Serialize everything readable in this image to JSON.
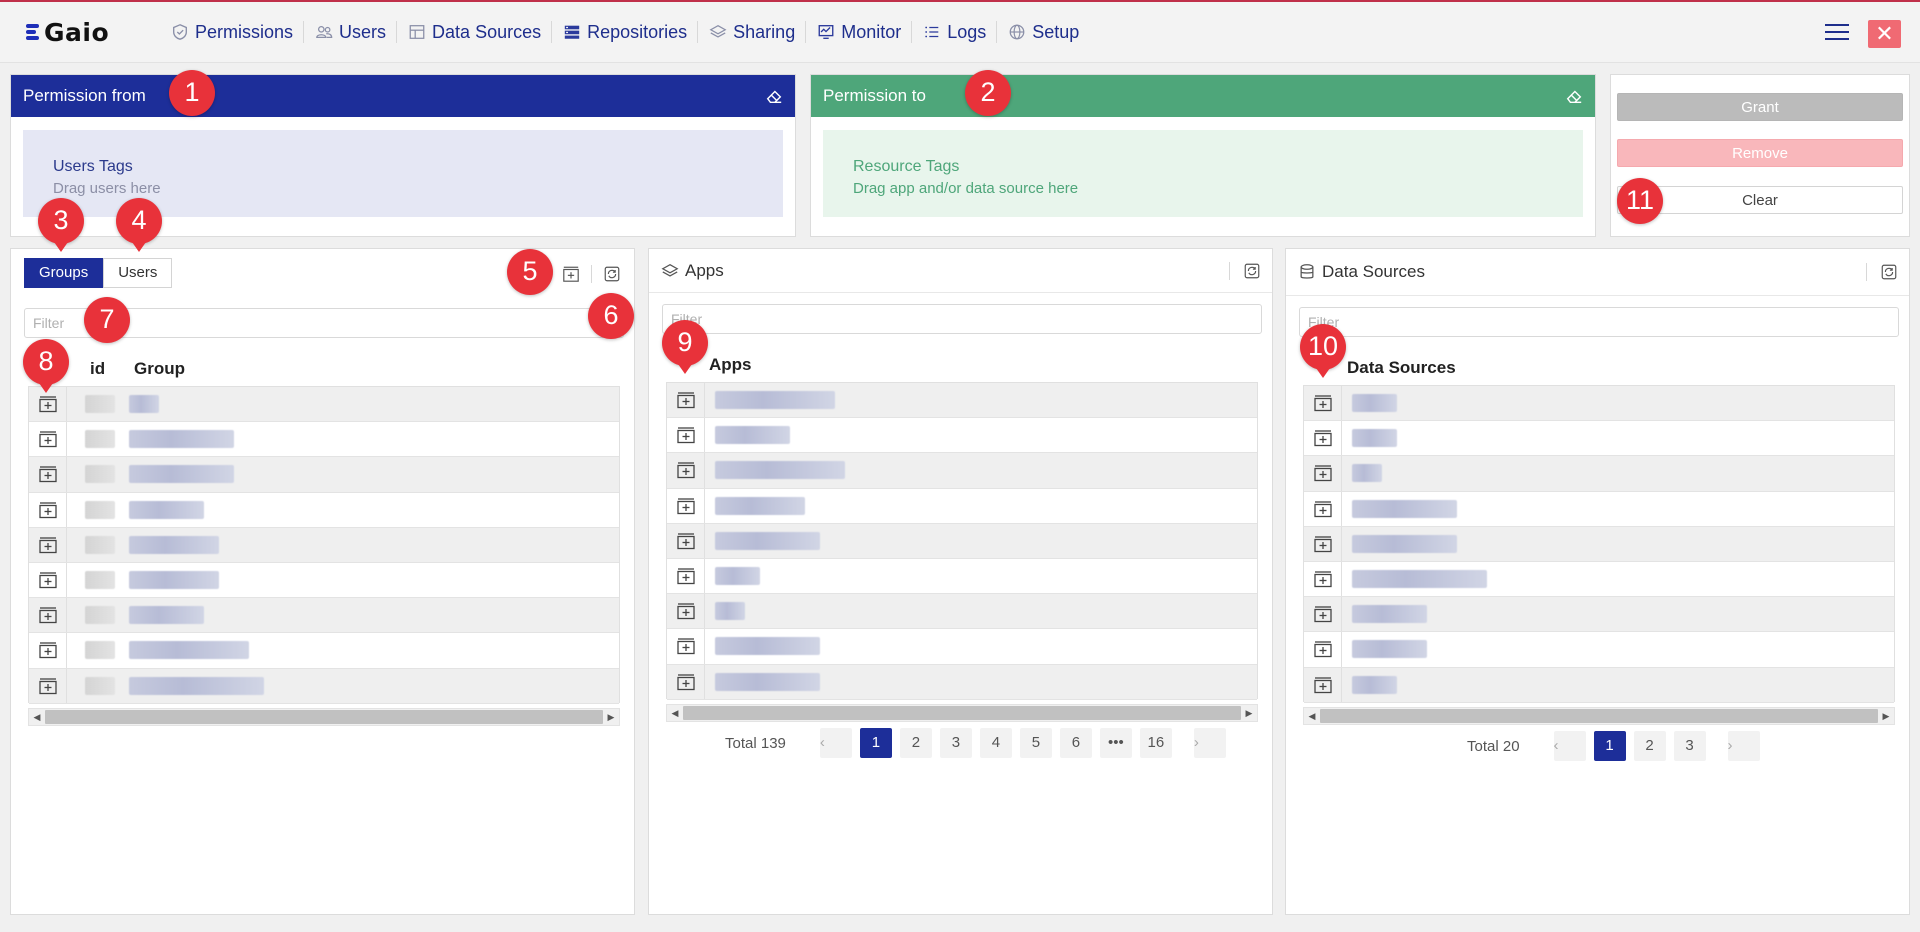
{
  "brand": {
    "name": "Gaio",
    "accent": "#1d2e99",
    "nav_color": "#1e2e8c"
  },
  "nav": [
    {
      "label": "Permissions",
      "icon": "shield-icon"
    },
    {
      "label": "Users",
      "icon": "users-icon"
    },
    {
      "label": "Data Sources",
      "icon": "datasource-icon"
    },
    {
      "label": "Repositories",
      "icon": "repositories-icon"
    },
    {
      "label": "Sharing",
      "icon": "layers-icon"
    },
    {
      "label": "Monitor",
      "icon": "monitor-icon"
    },
    {
      "label": "Logs",
      "icon": "list-icon"
    },
    {
      "label": "Setup",
      "icon": "globe-icon"
    }
  ],
  "window": {
    "close_label": "✕"
  },
  "permission_from": {
    "title": "Permission from",
    "drop_title": "Users Tags",
    "drop_hint": "Drag users here",
    "color": "#1d2e99"
  },
  "permission_to": {
    "title": "Permission to",
    "drop_title": "Resource Tags",
    "drop_hint": "Drag app and/or data source here",
    "color": "#4ea67a"
  },
  "actions": {
    "grant": "Grant",
    "remove": "Remove",
    "clear": "Clear"
  },
  "groups_panel": {
    "tabs": [
      "Groups",
      "Users"
    ],
    "active_tab": "Groups",
    "filter_placeholder": "Filter",
    "columns": [
      "id",
      "Group"
    ],
    "row_count": 9
  },
  "apps_panel": {
    "title": "Apps",
    "filter_placeholder": "Filter",
    "column": "Apps",
    "row_count": 9,
    "total": "Total 139",
    "pages": [
      "1",
      "2",
      "3",
      "4",
      "5",
      "6",
      "•••",
      "16"
    ],
    "current_page": "1"
  },
  "datasources_panel": {
    "title": "Data Sources",
    "filter_placeholder": "Filter",
    "column": "Data Sources",
    "row_count": 9,
    "total": "Total 20",
    "pages": [
      "1",
      "2",
      "3"
    ],
    "current_page": "1"
  },
  "markers": [
    "1",
    "2",
    "3",
    "4",
    "5",
    "6",
    "7",
    "8",
    "9",
    "10",
    "11"
  ]
}
